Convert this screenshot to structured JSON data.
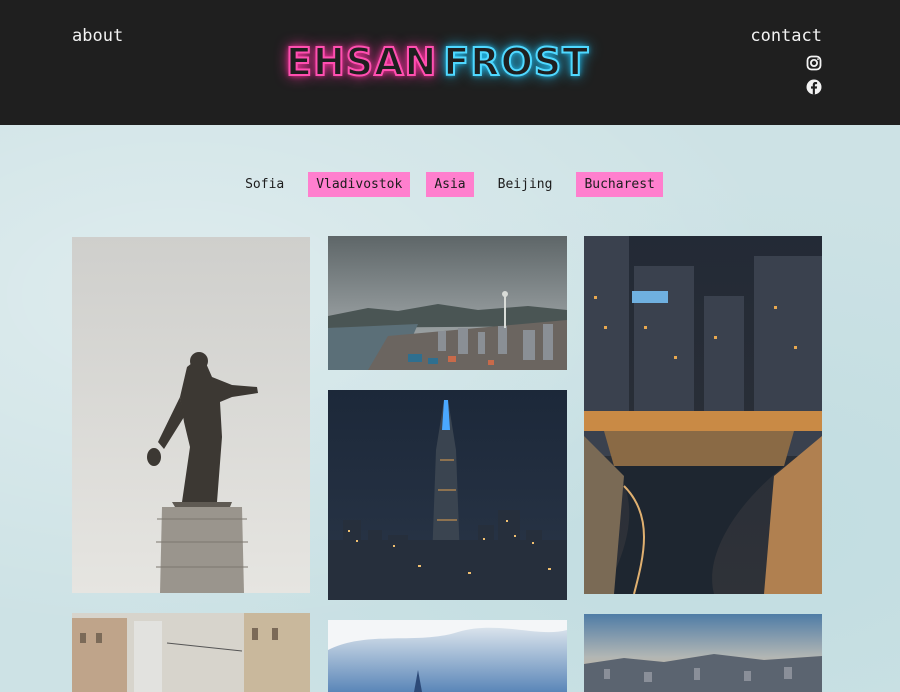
{
  "header": {
    "about_label": "about",
    "contact_label": "contact",
    "logo": {
      "part1": "EHSAN",
      "part2": "FROST"
    },
    "logo_colors": {
      "pink": "#ff4fb0",
      "cyan": "#4fd8ff"
    },
    "social": [
      "instagram-icon",
      "facebook-icon"
    ]
  },
  "tags": [
    {
      "label": "Sofia",
      "highlighted": false
    },
    {
      "label": "Vladivostok",
      "highlighted": true
    },
    {
      "label": "Asia",
      "highlighted": true
    },
    {
      "label": "Beijing",
      "highlighted": false
    },
    {
      "label": "Bucharest",
      "highlighted": true
    }
  ],
  "colors": {
    "header_bg": "#1f1f1f",
    "tag_highlight": "#ff7fce",
    "page_bg": "#cde2e5"
  },
  "photos": [
    "statue-photo",
    "coastal-city-photo",
    "skyscraper-night-photo",
    "stream-night-photo",
    "old-street-photo",
    "tower-sky-photo",
    "city-dusk-photo"
  ]
}
